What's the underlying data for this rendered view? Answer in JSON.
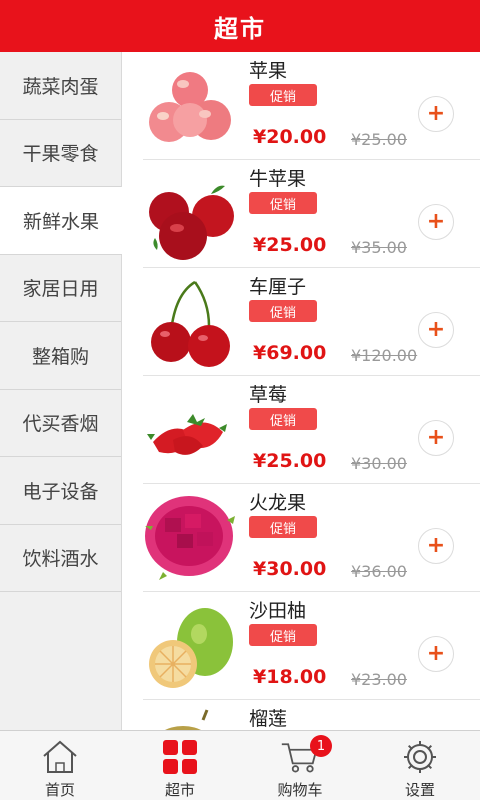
{
  "header": {
    "title": "超市"
  },
  "sidebar": {
    "items": [
      {
        "label": "蔬菜肉蛋"
      },
      {
        "label": "干果零食"
      },
      {
        "label": "新鲜水果"
      },
      {
        "label": "家居日用"
      },
      {
        "label": "整箱购"
      },
      {
        "label": "代买香烟"
      },
      {
        "label": "电子设备"
      },
      {
        "label": "饮料酒水"
      }
    ],
    "active_index": 2
  },
  "products": [
    {
      "name": "苹果",
      "promo": "促销",
      "price": "¥20.00",
      "old_price": "¥25.00",
      "image": "apple-image"
    },
    {
      "name": "牛苹果",
      "promo": "促销",
      "price": "¥25.00",
      "old_price": "¥35.00",
      "image": "red-apple-image"
    },
    {
      "name": "车厘子",
      "promo": "促销",
      "price": "¥69.00",
      "old_price": "¥120.00",
      "image": "cherry-image"
    },
    {
      "name": "草莓",
      "promo": "促销",
      "price": "¥25.00",
      "old_price": "¥30.00",
      "image": "strawberry-image"
    },
    {
      "name": "火龙果",
      "promo": "促销",
      "price": "¥30.00",
      "old_price": "¥36.00",
      "image": "dragonfruit-image"
    },
    {
      "name": "沙田柚",
      "promo": "促销",
      "price": "¥18.00",
      "old_price": "¥23.00",
      "image": "pomelo-image"
    },
    {
      "name": "榴莲",
      "image": "durian-image"
    }
  ],
  "add_symbol": "+",
  "tabbar": {
    "tabs": [
      {
        "label": "首页",
        "icon": "home-icon"
      },
      {
        "label": "超市",
        "icon": "grid-icon"
      },
      {
        "label": "购物车",
        "icon": "cart-icon",
        "badge": "1"
      },
      {
        "label": "设置",
        "icon": "gear-icon"
      }
    ],
    "active_index": 1
  },
  "colors": {
    "brand_red": "#e8121b",
    "price_red": "#e01414",
    "promo_red": "#f04a4a",
    "add_orange": "#e8501a"
  }
}
